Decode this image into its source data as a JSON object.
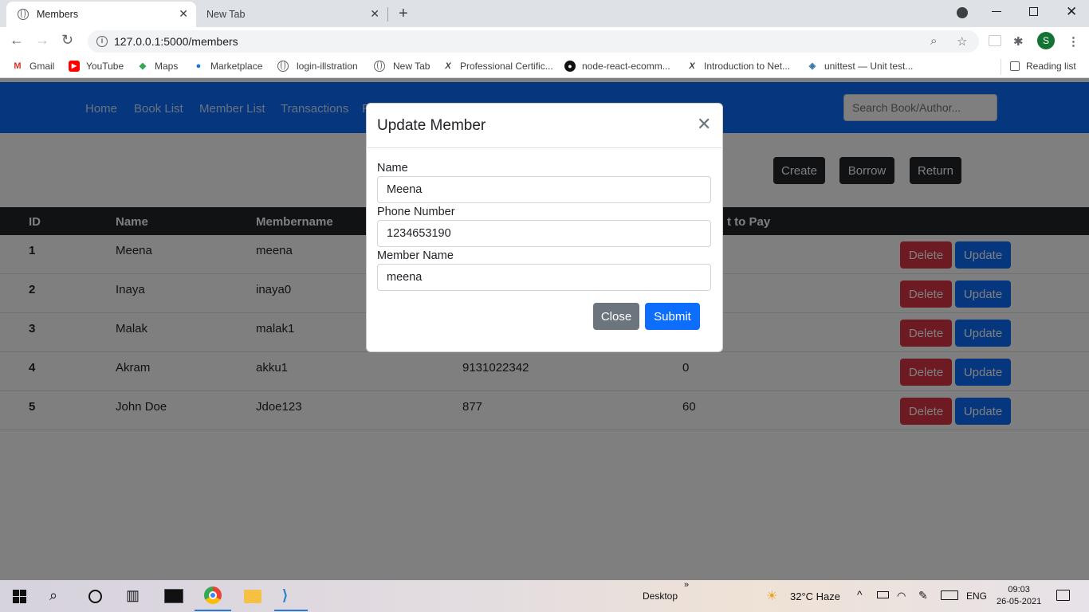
{
  "browser": {
    "tabs": [
      {
        "label": "Members",
        "close": "✕"
      },
      {
        "label": "New Tab",
        "close": "✕"
      }
    ],
    "new_tab_symbol": "+",
    "url": "127.0.0.1:5000/members",
    "profile_initial": "S",
    "bookmarks": [
      {
        "label": "Gmail",
        "icon": "gmail-icon"
      },
      {
        "label": "YouTube",
        "icon": "youtube-icon"
      },
      {
        "label": "Maps",
        "icon": "maps-icon"
      },
      {
        "label": "Marketplace",
        "icon": "marketplace-icon"
      },
      {
        "label": "login-illstration",
        "icon": "globe-icon"
      },
      {
        "label": "New Tab",
        "icon": "globe-icon"
      },
      {
        "label": "Professional Certific...",
        "icon": "x-icon"
      },
      {
        "label": "node-react-ecomm...",
        "icon": "github-icon"
      },
      {
        "label": "Introduction to Net...",
        "icon": "x-icon"
      },
      {
        "label": "unittest — Unit test...",
        "icon": "python-icon"
      }
    ],
    "reading_list": "Reading list"
  },
  "navbar": {
    "links": [
      "Home",
      "Book List",
      "Member List",
      "Transactions",
      "R"
    ],
    "search_placeholder": "Search Book/Author..."
  },
  "actions": {
    "create": "Create",
    "borrow": "Borrow",
    "return": "Return"
  },
  "table": {
    "headers": [
      "ID",
      "Name",
      "Membername",
      "t to Pay"
    ],
    "rows": [
      {
        "id": "1",
        "name": "Meena",
        "membername": "meena",
        "phone": "",
        "pay": ""
      },
      {
        "id": "2",
        "name": "Inaya",
        "membername": "inaya0",
        "phone": "",
        "pay": ""
      },
      {
        "id": "3",
        "name": "Malak",
        "membername": "malak1",
        "phone": "",
        "pay": ""
      },
      {
        "id": "4",
        "name": "Akram",
        "membername": "akku1",
        "phone": "9131022342",
        "pay": "0"
      },
      {
        "id": "5",
        "name": "John Doe",
        "membername": "Jdoe123",
        "phone": "877",
        "pay": "60"
      }
    ],
    "delete_label": "Delete",
    "update_label": "Update"
  },
  "modal": {
    "title": "Update Member",
    "close_symbol": "✕",
    "fields": [
      {
        "label": "Name",
        "value": "Meena"
      },
      {
        "label": "Phone Number",
        "value": "1234653190"
      },
      {
        "label": "Member Name",
        "value": "meena"
      }
    ],
    "close_button": "Close",
    "submit_button": "Submit"
  },
  "taskbar": {
    "desktop_label": "Desktop",
    "chevron": "»",
    "weather": "32°C  Haze",
    "language": "ENG",
    "time": "09:03",
    "date": "26-05-2021"
  },
  "colors": {
    "primary": "#0d6efd",
    "danger": "#dc3545",
    "secondary": "#6c757d",
    "dark": "#212529"
  }
}
